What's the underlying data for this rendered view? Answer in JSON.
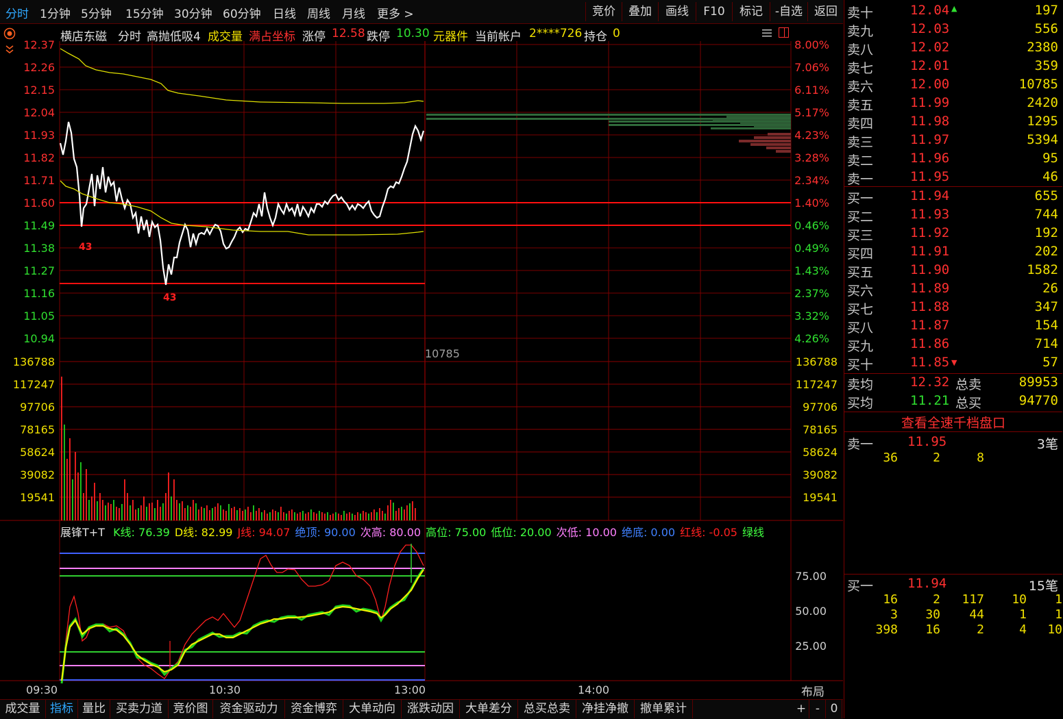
{
  "toolbar": {
    "tabs": [
      "分时",
      "1分钟",
      "5分钟",
      "15分钟",
      "30分钟",
      "60分钟",
      "日线",
      "周线",
      "月线",
      "更多 >"
    ],
    "right_buttons": [
      "竞价",
      "叠加",
      "画线",
      "F10",
      "标记",
      "-自选",
      "返回"
    ]
  },
  "title_line": {
    "stock_name": "横店东磁",
    "mode": "分时",
    "indicator": "高抛低吸4",
    "volume_label": "成交量",
    "full_axis": "满占坐标",
    "limit_up_label": "涨停",
    "limit_up_value": "12.58",
    "limit_down_label": "跌停",
    "limit_down_value": "10.30",
    "sector": "元器件",
    "account_label": "当前帐户",
    "account_value": "2****726",
    "position_label": "持仓",
    "position_value": "0"
  },
  "price_axis": {
    "left": [
      "12.37",
      "12.26",
      "12.15",
      "12.04",
      "11.93",
      "11.82",
      "11.71",
      "11.60",
      "11.49",
      "11.38",
      "11.27",
      "11.16",
      "11.05",
      "10.94"
    ],
    "right": [
      "8.00%",
      "7.06%",
      "6.11%",
      "5.17%",
      "4.23%",
      "3.28%",
      "2.34%",
      "1.40%",
      "0.46%",
      "0.49%",
      "1.43%",
      "2.37%",
      "3.32%",
      "4.26%"
    ]
  },
  "volume_axis": [
    "136788",
    "117247",
    "97706",
    "78165",
    "58624",
    "39082",
    "19541"
  ],
  "volume_cursor_label": "10785",
  "kdj_line": {
    "name": "展锋T+T",
    "items": [
      {
        "text": "K线: 76.39",
        "color": "#40ff40"
      },
      {
        "text": "D线: 82.99",
        "color": "#f0f000"
      },
      {
        "text": "J线: 94.07",
        "color": "#ff2020"
      },
      {
        "text": "绝顶: 90.00",
        "color": "#4080ff"
      },
      {
        "text": "次高: 80.00",
        "color": "#ff80ff"
      },
      {
        "text": "高位: 75.00",
        "color": "#40ff40"
      },
      {
        "text": "低位: 20.00",
        "color": "#40ff40"
      },
      {
        "text": "次低: 10.00",
        "color": "#ff80ff"
      },
      {
        "text": "绝底: 0.00",
        "color": "#4080ff"
      },
      {
        "text": "红线: -0.05",
        "color": "#ff2020"
      },
      {
        "text": "绿线",
        "color": "#40ff40"
      }
    ],
    "axis": [
      "75.00",
      "50.00",
      "25.00"
    ]
  },
  "time_axis": [
    "09:30",
    "10:30",
    "13:00",
    "14:00"
  ],
  "layout_label": "布局",
  "bottom_tabs": [
    "成交量",
    "指标",
    "量比",
    "买卖力道",
    "竞价图",
    "资金驱动力",
    "资金博弈",
    "大单动向",
    "涨跌动因",
    "大单差分",
    "总买总卖",
    "净挂净撤",
    "撤单累计"
  ],
  "bottom_right": [
    "+",
    "-",
    "0"
  ],
  "sell_orders": [
    {
      "label": "卖十",
      "price": "12.04",
      "vol": "197"
    },
    {
      "label": "卖九",
      "price": "12.03",
      "vol": "556"
    },
    {
      "label": "卖八",
      "price": "12.02",
      "vol": "2380"
    },
    {
      "label": "卖七",
      "price": "12.01",
      "vol": "359"
    },
    {
      "label": "卖六",
      "price": "12.00",
      "vol": "10785"
    },
    {
      "label": "卖五",
      "price": "11.99",
      "vol": "2420"
    },
    {
      "label": "卖四",
      "price": "11.98",
      "vol": "1295"
    },
    {
      "label": "卖三",
      "price": "11.97",
      "vol": "5394"
    },
    {
      "label": "卖二",
      "price": "11.96",
      "vol": "95"
    },
    {
      "label": "卖一",
      "price": "11.95",
      "vol": "46"
    }
  ],
  "buy_orders": [
    {
      "label": "买一",
      "price": "11.94",
      "vol": "655"
    },
    {
      "label": "买二",
      "price": "11.93",
      "vol": "744"
    },
    {
      "label": "买三",
      "price": "11.92",
      "vol": "192"
    },
    {
      "label": "买四",
      "price": "11.91",
      "vol": "202"
    },
    {
      "label": "买五",
      "price": "11.90",
      "vol": "1582"
    },
    {
      "label": "买六",
      "price": "11.89",
      "vol": "26"
    },
    {
      "label": "买七",
      "price": "11.88",
      "vol": "347"
    },
    {
      "label": "买八",
      "price": "11.87",
      "vol": "154"
    },
    {
      "label": "买九",
      "price": "11.86",
      "vol": "714"
    },
    {
      "label": "买十",
      "price": "11.85",
      "vol": "57"
    }
  ],
  "averages": {
    "sell_avg_label": "卖均",
    "sell_avg": "12.32",
    "total_sell_label": "总卖",
    "total_sell": "89953",
    "buy_avg_label": "买均",
    "buy_avg": "11.21",
    "total_buy_label": "总买",
    "total_buy": "94770"
  },
  "view_full_depth": "查看全速千档盘口",
  "queue_sell": {
    "label": "卖一",
    "price": "11.95",
    "count": "3笔",
    "orders": [
      "36",
      "2",
      "8"
    ]
  },
  "queue_buy": {
    "label": "买一",
    "price": "11.94",
    "count": "15笔",
    "orders": [
      [
        "16",
        "2",
        "117",
        "10",
        "1"
      ],
      [
        "3",
        "30",
        "44",
        "1",
        "1"
      ],
      [
        "398",
        "16",
        "2",
        "4",
        "10"
      ]
    ]
  },
  "colors": {
    "up": "#ff3030",
    "down": "#30e030",
    "grid": "#8a0000",
    "price_line": "#ffffff",
    "avg_line": "#e0e000"
  },
  "icons": [
    "settings-circle-icon",
    "collapse-chevron-icon",
    "menu-icon",
    "window-icon"
  ]
}
